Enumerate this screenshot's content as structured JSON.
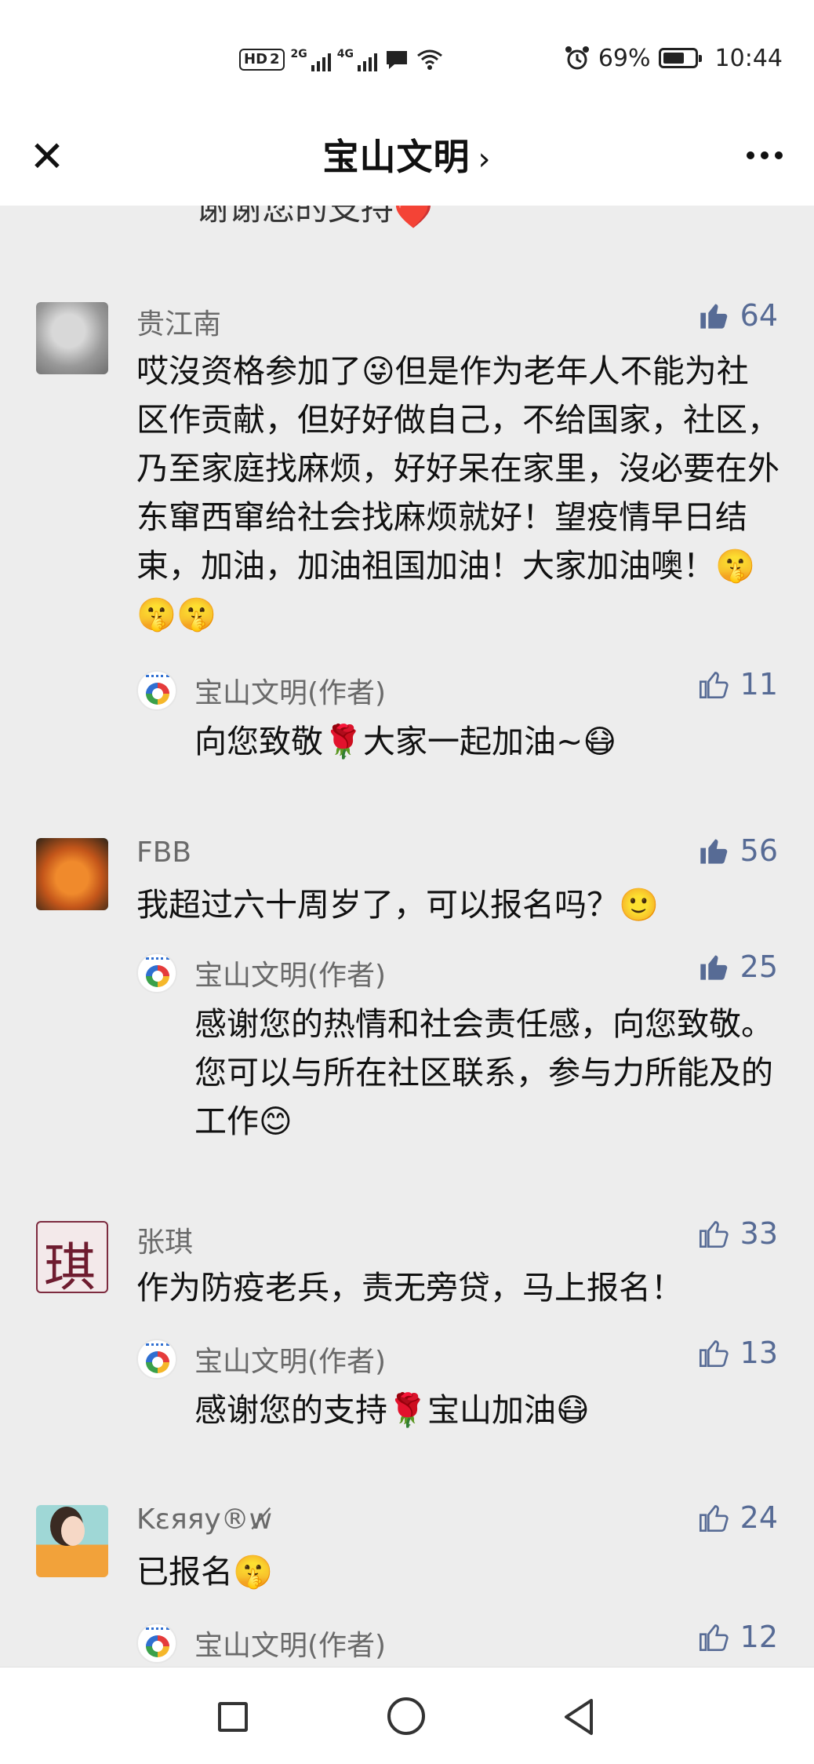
{
  "status_bar": {
    "hd": "HD",
    "sim": "2",
    "net1": "2G",
    "net2": "4G",
    "battery_pct": "69%",
    "battery_level": 0.69,
    "time": "10:44"
  },
  "nav": {
    "title": "宝山文明",
    "chevron": "›",
    "close_icon": "close-icon",
    "more_icon": "more-icon"
  },
  "partial_text": "谢谢您的支持",
  "comments": [
    {
      "name": "贵江南",
      "likes": "64",
      "liked": true,
      "text": "哎沒资格参加了😜但是作为老年人不能为社区作贡献，但好好做自己，不给国家，社区，乃至家庭找麻烦，好好呆在家里，沒必要在外东窜西窜给社会找麻烦就好！望疫情早日结束，加油，加油祖国加油！大家加油噢！🤫🤫🤫",
      "reply": {
        "name": "宝山文明(作者)",
        "likes": "11",
        "liked": false,
        "text": "向您致敬🌹大家一起加油~😷"
      }
    },
    {
      "name": "FBB",
      "likes": "56",
      "liked": true,
      "text": "我超过六十周岁了，可以报名吗？🙂",
      "reply": {
        "name": "宝山文明(作者)",
        "likes": "25",
        "liked": true,
        "text": "感谢您的热情和社会责任感，向您致敬。您可以与所在社区联系，参与力所能及的工作😊"
      }
    },
    {
      "name": "张琪",
      "likes": "33",
      "liked": false,
      "text": "作为防疫老兵，责无旁贷，马上报名！",
      "reply": {
        "name": "宝山文明(作者)",
        "likes": "13",
        "liked": false,
        "text": "感谢您的支持🌹宝山加油😷"
      }
    },
    {
      "name": "Kεяяу®ᴡ̸",
      "likes": "24",
      "liked": false,
      "text": "已报名🤫",
      "reply": {
        "name": "宝山文明(作者)",
        "likes": "12",
        "liked": false,
        "text": ""
      }
    }
  ],
  "colors": {
    "link_blue": "#576b95",
    "bg": "#ededed"
  }
}
